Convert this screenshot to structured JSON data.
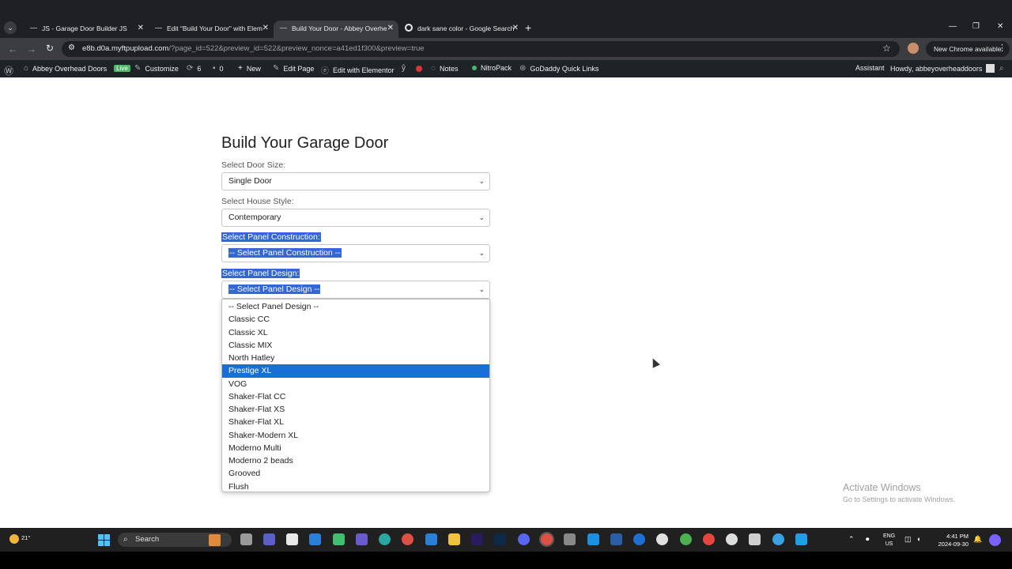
{
  "browser": {
    "tabs": [
      {
        "title": "JS - Garage Door Builder JS",
        "active": false
      },
      {
        "title": "Edit “Build Your Door” with Elem",
        "active": false
      },
      {
        "title": "Build Your Door - Abbey Overhe",
        "active": true
      },
      {
        "title": "dark sane color - Google Search",
        "active": false
      }
    ],
    "url_host": "e8b.d0a.myftpupload.com",
    "url_path": "/?page_id=522&preview_id=522&preview_nonce=a41ed1f300&preview=true",
    "update_label": "New Chrome available"
  },
  "adminbar": {
    "site_name": "Abbey Overhead Doors",
    "live_badge": "Live",
    "customize": "Customize",
    "updates_count": "6",
    "comments_count": "0",
    "new_label": "New",
    "edit_page": "Edit Page",
    "edit_elementor": "Edit with Elementor",
    "notes": "Notes",
    "nitropack": "NitroPack",
    "godaddy": "GoDaddy Quick Links",
    "assistant": "Assistant",
    "howdy": "Howdy, abbeyoverheaddoors"
  },
  "form": {
    "title": "Build Your Garage Door",
    "door_size_label": "Select Door Size:",
    "door_size_value": "Single Door",
    "house_style_label": "Select House Style:",
    "house_style_value": "Contemporary",
    "panel_construction_label": "Select Panel Construction:",
    "panel_construction_value": "-- Select Panel Construction --",
    "panel_design_label": "Select Panel Design:",
    "panel_design_value": "-- Select Panel Design --"
  },
  "dropdown": {
    "options": [
      "-- Select Panel Design --",
      "Classic CC",
      "Classic XL",
      "Classic MIX",
      "North Hatley",
      "Prestige XL",
      "VOG",
      "Shaker-Flat CC",
      "Shaker-Flat XS",
      "Shaker-Flat XL",
      "Shaker-Modern XL",
      "Moderno Multi",
      "Moderno 2 beads",
      "Grooved",
      "Flush"
    ],
    "highlighted_index": 5
  },
  "watermark": {
    "line1": "Activate Windows",
    "line2": "Go to Settings to activate Windows."
  },
  "taskbar": {
    "temperature": "21°",
    "search_placeholder": "Search",
    "lang_line1": "ENG",
    "lang_line2": "US",
    "time": "4:41 PM",
    "date": "2024-09-30"
  },
  "colors": {
    "selection_blue": "#3367d6",
    "highlight_blue": "#1a6fd6",
    "adminbar_bg": "#1d2327",
    "chrome_dark": "#1f2023"
  }
}
